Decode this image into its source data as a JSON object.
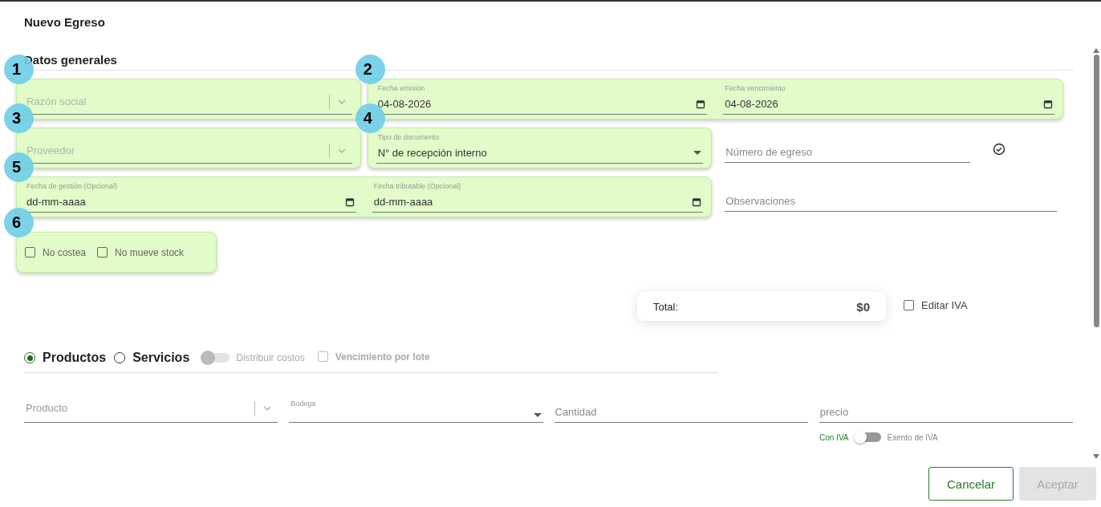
{
  "title": "Nuevo Egreso",
  "section": "Datos generales",
  "rows": [
    {
      "items": [
        {
          "kind": "group",
          "number": "1",
          "fields": [
            {
              "kind": "select",
              "placeholder": "Razón social"
            }
          ]
        },
        {
          "kind": "group",
          "number": "2",
          "fields": [
            {
              "kind": "date",
              "label": "Fecha emisión",
              "value": "04-08-2026"
            },
            {
              "kind": "date",
              "label": "Fecha vencimiento",
              "value": "04-08-2026"
            }
          ]
        }
      ]
    },
    {
      "items": [
        {
          "kind": "group",
          "number": "3",
          "fields": [
            {
              "kind": "select",
              "placeholder": "Proveedor"
            }
          ]
        },
        {
          "kind": "group",
          "number": "4",
          "fields": [
            {
              "kind": "dropdown",
              "label": "Tipo de documento",
              "value": "N° de recepción interno"
            }
          ]
        },
        {
          "kind": "field",
          "field": {
            "kind": "verified_text",
            "placeholder": "Número de egreso"
          }
        }
      ]
    },
    {
      "items": [
        {
          "kind": "group",
          "number": "5",
          "fields": [
            {
              "kind": "date",
              "label": "Fecha de gestión (Opcional)",
              "placeholder": "dd-mm-aaaa"
            },
            {
              "kind": "date",
              "label": "Fecha tributable (Opcional)",
              "placeholder": "dd-mm-aaaa"
            }
          ]
        },
        {
          "kind": "field",
          "field": {
            "kind": "text",
            "placeholder": "Observaciones"
          }
        }
      ]
    },
    {
      "items": [
        {
          "kind": "checks",
          "number": "6",
          "checkboxes": [
            {
              "label": "No costea",
              "checked": false
            },
            {
              "label": "No mueve stock",
              "checked": false
            }
          ]
        }
      ]
    }
  ],
  "total": {
    "label": "Total:",
    "value": "$0"
  },
  "edit_iva": {
    "label": "Editar IVA",
    "checked": false
  },
  "item_types": [
    {
      "label": "Productos",
      "selected": true
    },
    {
      "label": "Servicios",
      "selected": false
    }
  ],
  "distribute_costs": {
    "label": "Distribuir costos",
    "on": false
  },
  "lot_expiry": {
    "label": "Vencimiento por lote",
    "checked": false
  },
  "line_fields": [
    {
      "kind": "select",
      "placeholder": "Producto"
    },
    {
      "kind": "dropdown",
      "label": "Bodega"
    },
    {
      "kind": "text",
      "placeholder": "Cantidad"
    },
    {
      "kind": "text",
      "placeholder": "precio"
    }
  ],
  "iva_toggle": {
    "left": "Con IVA",
    "right": "Exento de IVA",
    "on": false
  },
  "buttons": [
    {
      "label": "Cancelar",
      "disabled": false
    },
    {
      "label": "Aceptar",
      "disabled": true
    }
  ]
}
